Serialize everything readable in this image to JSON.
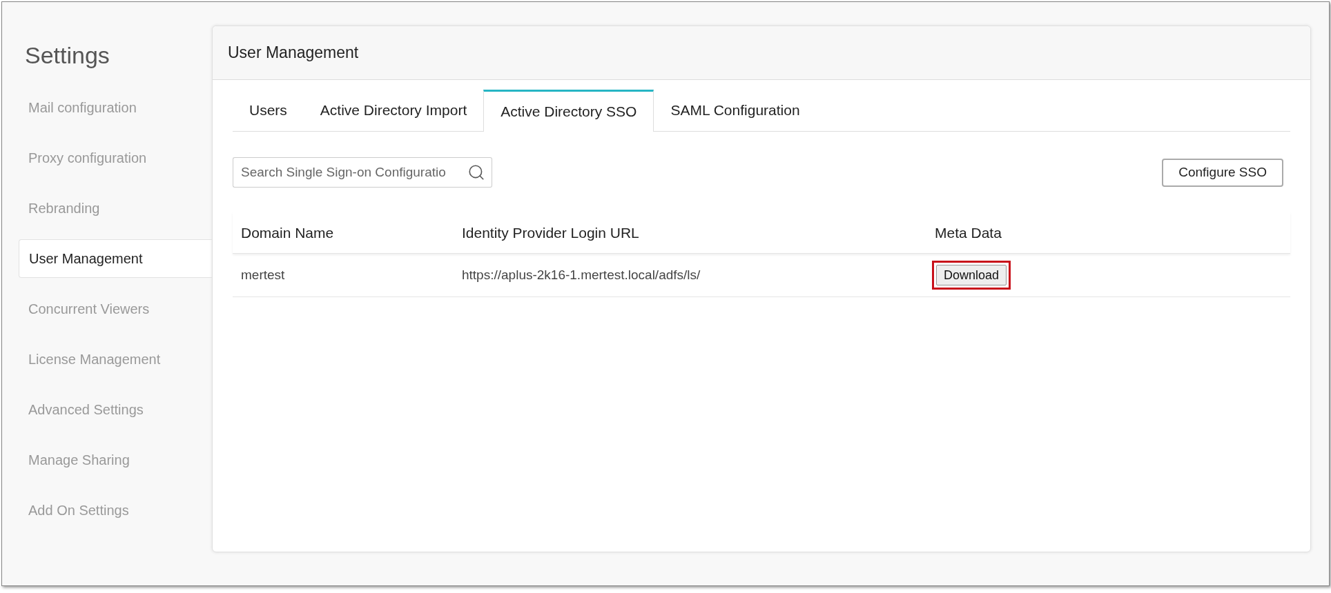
{
  "sidebar": {
    "title": "Settings",
    "items": [
      {
        "label": "Mail configuration",
        "selected": false
      },
      {
        "label": "Proxy configuration",
        "selected": false
      },
      {
        "label": "Rebranding",
        "selected": false
      },
      {
        "label": "User Management",
        "selected": true
      },
      {
        "label": "Concurrent Viewers",
        "selected": false
      },
      {
        "label": "License Management",
        "selected": false
      },
      {
        "label": "Advanced Settings",
        "selected": false
      },
      {
        "label": "Manage Sharing",
        "selected": false
      },
      {
        "label": "Add On Settings",
        "selected": false
      }
    ]
  },
  "panel": {
    "title": "User Management",
    "tabs": [
      {
        "label": "Users",
        "selected": false
      },
      {
        "label": "Active Directory Import",
        "selected": false
      },
      {
        "label": "Active Directory SSO",
        "selected": true
      },
      {
        "label": "SAML Configuration",
        "selected": false
      }
    ],
    "search": {
      "placeholder": "Search Single Sign-on Configuratio"
    },
    "configure_button": "Configure SSO",
    "table": {
      "columns": [
        "Domain Name",
        "Identity Provider Login URL",
        "Meta Data"
      ],
      "rows": [
        {
          "domain": "mertest",
          "url": "https://aplus-2k16-1.mertest.local/adfs/ls/",
          "action": {
            "label": "Download",
            "highlighted": true
          }
        }
      ]
    }
  }
}
